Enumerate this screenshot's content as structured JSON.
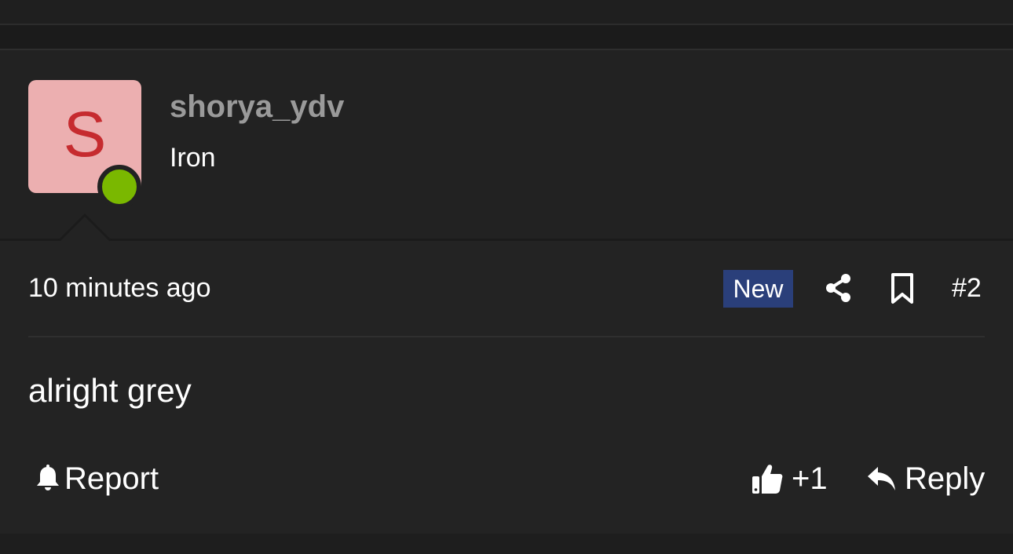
{
  "post": {
    "author": {
      "avatar_letter": "S",
      "avatar_bg": "#ecafb0",
      "avatar_letter_color": "#c62b2f",
      "online_color": "#7ab800",
      "username": "shorya_ydv",
      "title": "Iron"
    },
    "meta": {
      "timestamp": "10 minutes ago",
      "badge": "New",
      "badge_color": "#2a3f7a",
      "post_number": "#2"
    },
    "body": "alright grey",
    "actions": {
      "report_label": "Report",
      "like_count": "+1",
      "reply_label": "Reply"
    }
  },
  "icons": {
    "online": "online-status-dot",
    "share": "share-icon",
    "bookmark": "bookmark-icon",
    "report": "bell-icon",
    "like": "thumbs-up-icon",
    "reply": "reply-arrow-icon"
  }
}
